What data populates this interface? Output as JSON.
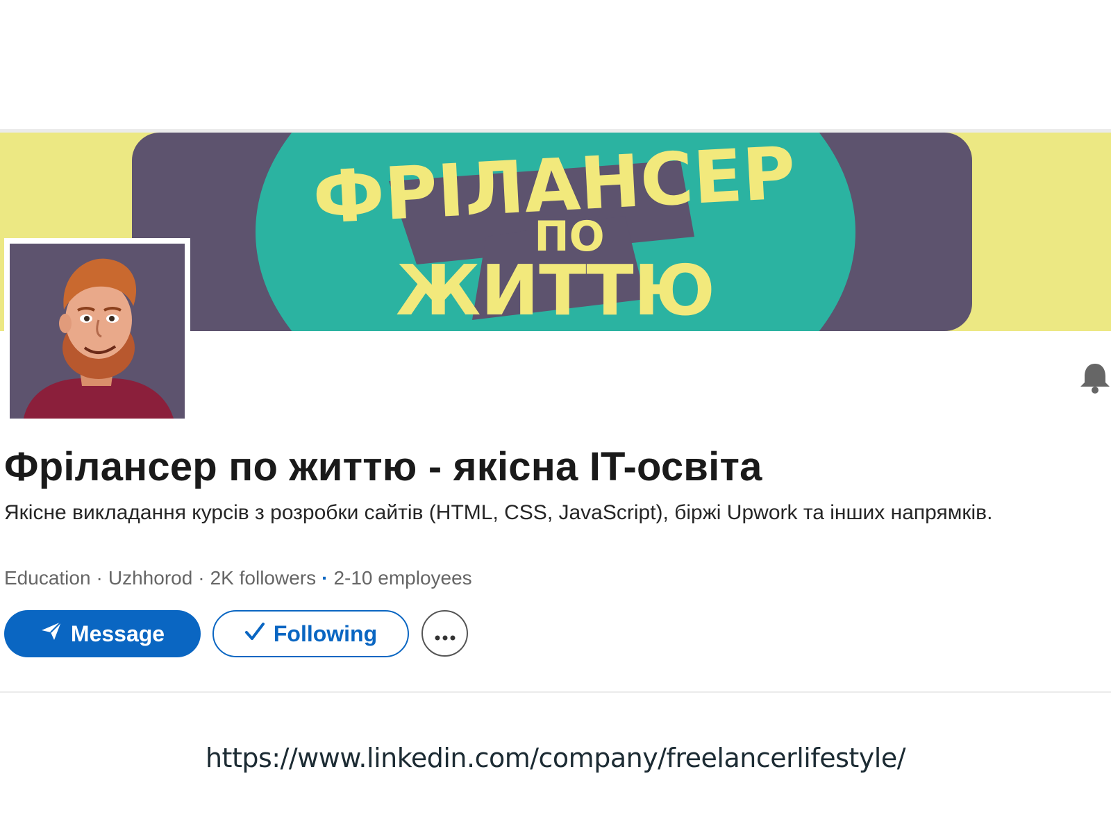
{
  "banner": {
    "logo_line1": "ФРІЛАНСЕР",
    "logo_line2": "ПО",
    "logo_line3": "ЖИТТЮ",
    "colors": {
      "yellow": "#ece883",
      "purple": "#5d536e",
      "teal": "#2bb3a1",
      "logo_text": "#f2e97c"
    }
  },
  "profile": {
    "avatar_icon": "avatar-illustration",
    "name": "Фрілансер по життю - якісна IT-освіта",
    "tagline": "Якісне викладання курсів з розробки сайтів (HTML, CSS, JavaScript), біржі Upwork та інших напрямків.",
    "meta": {
      "industry": "Education",
      "location": "Uzhhorod",
      "followers": "2K followers",
      "employees": "2-10 employees",
      "separator": "·"
    },
    "notifications_icon": "bell-icon"
  },
  "actions": {
    "message_label": "Message",
    "message_icon": "send-icon",
    "following_label": "Following",
    "following_icon": "check-icon",
    "more_icon": "more-horizontal-icon",
    "more_label": "···"
  },
  "footer": {
    "url": "https://www.linkedin.com/company/freelancerlifestyle/"
  },
  "colors": {
    "brand_blue": "#0a66c2",
    "text_dark": "#1a1a1a",
    "text_muted": "#666666"
  }
}
